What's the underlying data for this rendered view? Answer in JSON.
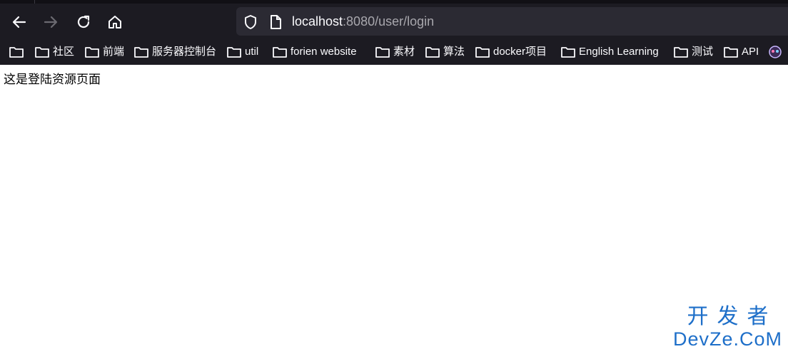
{
  "browser": {
    "url_host": "localhost",
    "url_rest": ":8080/user/login"
  },
  "bookmarks": [
    {
      "label": "社区"
    },
    {
      "label": "前端"
    },
    {
      "label": "服务器控制台"
    },
    {
      "label": "util"
    },
    {
      "label": "forien website"
    },
    {
      "label": "素材"
    },
    {
      "label": "算法"
    },
    {
      "label": "docker项目"
    },
    {
      "label": "English Learning"
    },
    {
      "label": "测试"
    },
    {
      "label": "API"
    }
  ],
  "page": {
    "body_text": "这是登陆资源页面"
  },
  "watermark": {
    "line1": "开发者",
    "line2": "DevZe.CoM"
  },
  "icons": [
    "back-icon",
    "forward-icon",
    "reload-icon",
    "home-icon",
    "shield-icon",
    "page-icon",
    "folder-icon",
    "extension-icon"
  ],
  "colors": {
    "toolbar_bg": "#1c1b22",
    "urlbar_bg": "#2b2a33",
    "watermark": "#1e6fc9"
  }
}
